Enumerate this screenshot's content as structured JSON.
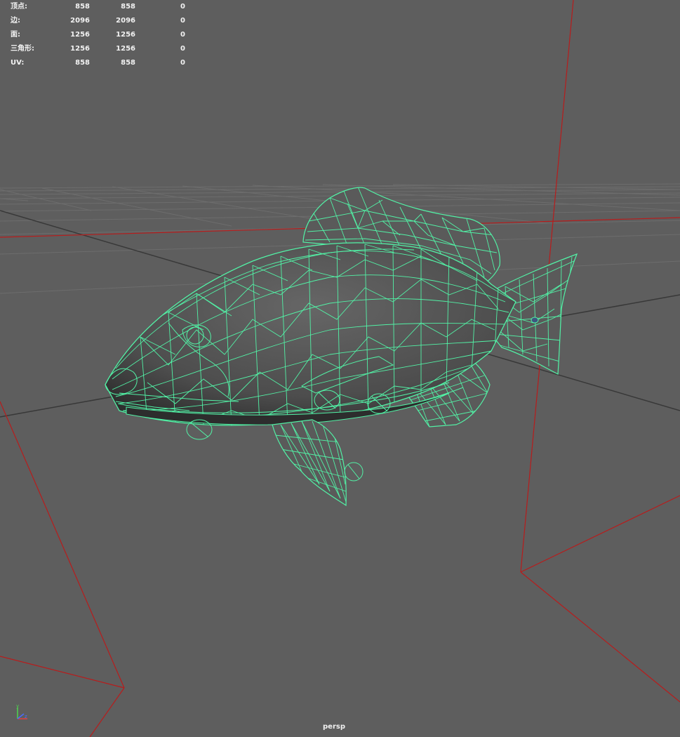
{
  "hud": {
    "rows": [
      {
        "label": "顶点:",
        "v1": "858",
        "v2": "858",
        "v3": "0"
      },
      {
        "label": "边:",
        "v1": "2096",
        "v2": "2096",
        "v3": "0"
      },
      {
        "label": "面:",
        "v1": "1256",
        "v2": "1256",
        "v3": "0"
      },
      {
        "label": "三角形:",
        "v1": "1256",
        "v2": "1256",
        "v3": "0"
      },
      {
        "label": "UV:",
        "v1": "858",
        "v2": "858",
        "v3": "0"
      }
    ]
  },
  "camera": {
    "name": "persp"
  },
  "axis": {
    "y": "y",
    "z": "z"
  },
  "colors": {
    "background": "#5e5e5e",
    "grid": "#6e6e6e",
    "grid_axis": "#383838",
    "frustum": "#b81c1c",
    "wireframe": "#52f2a6",
    "body_fill": "#4c4c4c"
  },
  "model": {
    "name": "fish-wireframe-mesh"
  }
}
